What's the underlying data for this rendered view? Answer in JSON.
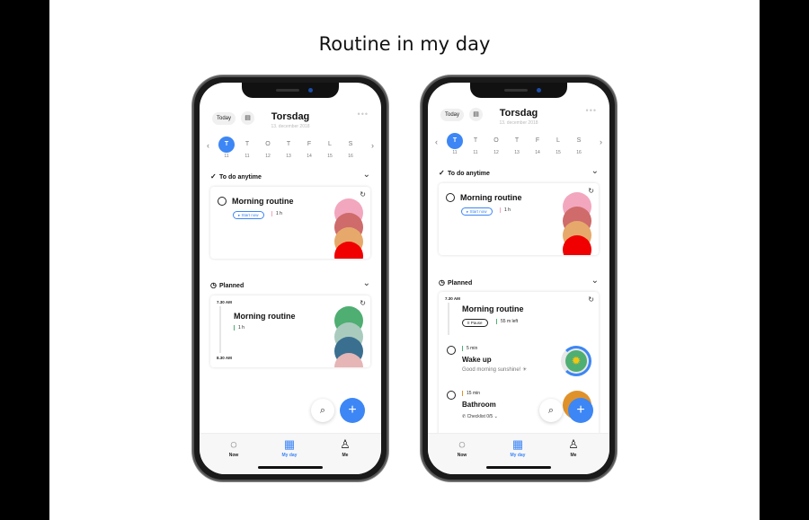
{
  "page_title": "Routine in my day",
  "phones": [
    {
      "header": {
        "today": "Today",
        "title": "Torsdag",
        "date": "13. december 2018"
      },
      "week": [
        {
          "l": "T",
          "n": "11",
          "sel": true
        },
        {
          "l": "T",
          "n": "11"
        },
        {
          "l": "O",
          "n": "12"
        },
        {
          "l": "T",
          "n": "13"
        },
        {
          "l": "F",
          "n": "14"
        },
        {
          "l": "L",
          "n": "15"
        },
        {
          "l": "S",
          "n": "16"
        }
      ],
      "anytime": {
        "label": "To do anytime",
        "card": {
          "title": "Morning routine",
          "pill": "▸ Start now",
          "meta": "1 h",
          "colors": [
            "#f2a7bf",
            "#cf6b6b",
            "#e6a96b",
            "#f00000"
          ]
        }
      },
      "planned": {
        "label": "Planned",
        "start": "7.30 AM",
        "end": "8.30 AM",
        "title": "Morning routine",
        "meta": "1 h",
        "colors": [
          "#4fae72",
          "#a9cbbd",
          "#3a6f90",
          "#e6b5b5"
        ]
      },
      "tabs": [
        {
          "label": "Now",
          "icon": "◌"
        },
        {
          "label": "My day",
          "icon": "▦",
          "active": true
        },
        {
          "label": "Me",
          "icon": "♙"
        }
      ]
    },
    {
      "header": {
        "today": "Today",
        "title": "Torsdag",
        "date": "13. december 2018"
      },
      "week": [
        {
          "l": "T",
          "n": "11",
          "sel": true
        },
        {
          "l": "T",
          "n": "11"
        },
        {
          "l": "O",
          "n": "12"
        },
        {
          "l": "T",
          "n": "13"
        },
        {
          "l": "F",
          "n": "14"
        },
        {
          "l": "L",
          "n": "15"
        },
        {
          "l": "S",
          "n": "16"
        }
      ],
      "anytime": {
        "label": "To do anytime",
        "card": {
          "title": "Morning routine",
          "pill": "▸ Start now",
          "meta": "1 h",
          "colors": [
            "#f2a7bf",
            "#cf6b6b",
            "#e6a96b",
            "#f00000"
          ]
        }
      },
      "planned": {
        "label": "Planned",
        "start": "7.30 AM",
        "title": "Morning routine",
        "pill": "II Pause",
        "meta": "55 m left",
        "steps": [
          {
            "dur": "5 min",
            "title": "Wake up",
            "sub": "Good morning sunshine! ☀",
            "color": "#4fae72"
          },
          {
            "dur": "15 min",
            "title": "Bathroom",
            "sub": "Checklist 0/5 ⌄",
            "color": "#e0922a"
          }
        ]
      },
      "tabs": [
        {
          "label": "Now",
          "icon": "◌"
        },
        {
          "label": "My day",
          "icon": "▦",
          "active": true
        },
        {
          "label": "Me",
          "icon": "♙"
        }
      ]
    }
  ]
}
